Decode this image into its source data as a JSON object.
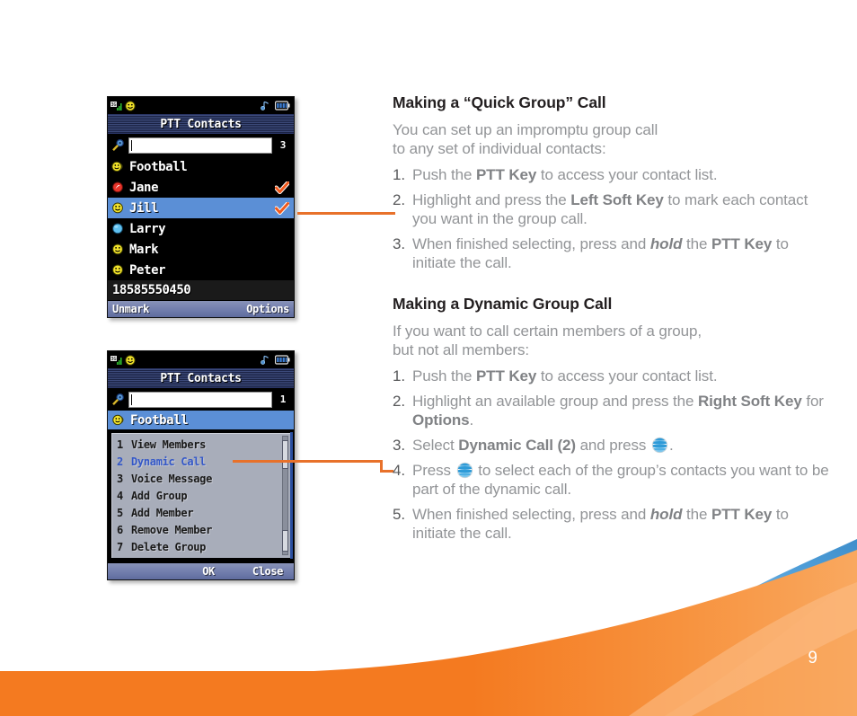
{
  "page": {
    "number": "9",
    "accent_orange": "#f47920",
    "accent_blue": "#5b9bd5",
    "callout_color": "#e8712a",
    "body_text_color": "#929497",
    "heading_color": "#231f20"
  },
  "phone1": {
    "statusbar": {
      "signal_icon": "3g-signal-icon",
      "presence_icon": "smiley-icon",
      "music_icon": "music-note-icon",
      "battery_icon": "battery-icon"
    },
    "title": "PTT Contacts",
    "search": {
      "value": "",
      "placeholder": "",
      "count": "3",
      "icon": "search-magnifier-icon"
    },
    "contacts": [
      {
        "name": "Football",
        "presence": "group-smiley",
        "checked": false,
        "selected": false
      },
      {
        "name": "Jane",
        "presence": "red-busy",
        "checked": true,
        "selected": false
      },
      {
        "name": "Jill",
        "presence": "yellow-smiley",
        "checked": true,
        "selected": true
      },
      {
        "name": "Larry",
        "presence": "blue-offline",
        "checked": false,
        "selected": false
      },
      {
        "name": "Mark",
        "presence": "yellow-smiley",
        "checked": false,
        "selected": false
      },
      {
        "name": "Peter",
        "presence": "yellow-smiley",
        "checked": false,
        "selected": false
      }
    ],
    "number": "18585550450",
    "softkeys": {
      "left": "Unmark",
      "right": "Options"
    }
  },
  "phone2": {
    "statusbar": {
      "signal_icon": "3g-signal-icon",
      "presence_icon": "smiley-icon",
      "music_icon": "music-note-icon",
      "battery_icon": "battery-icon"
    },
    "title": "PTT Contacts",
    "search": {
      "value": "",
      "placeholder": "",
      "count": "1",
      "icon": "search-magnifier-icon"
    },
    "group": {
      "name": "Football",
      "presence": "group-smiley"
    },
    "menu": [
      {
        "num": "1",
        "label": "View Members",
        "highlighted": false
      },
      {
        "num": "2",
        "label": "Dynamic Call",
        "highlighted": true
      },
      {
        "num": "3",
        "label": "Voice Message",
        "highlighted": false
      },
      {
        "num": "4",
        "label": "Add Group",
        "highlighted": false
      },
      {
        "num": "5",
        "label": "Add Member",
        "highlighted": false
      },
      {
        "num": "6",
        "label": "Remove Member",
        "highlighted": false
      },
      {
        "num": "7",
        "label": "Delete Group",
        "highlighted": false
      }
    ],
    "softkeys": {
      "left": "OK",
      "right": "Close"
    }
  },
  "section1": {
    "heading": "Making a “Quick Group” Call",
    "lead_line1": "You can set up an impromptu group call",
    "lead_line2": "to any set of individual contacts:",
    "steps": [
      {
        "num": "1.",
        "parts": [
          {
            "t": "Push the ",
            "b": false
          },
          {
            "t": "PTT Key",
            "b": true
          },
          {
            "t": " to access your contact list.",
            "b": false
          }
        ]
      },
      {
        "num": "2.",
        "parts": [
          {
            "t": "Highlight and press the ",
            "b": false
          },
          {
            "t": "Left Soft Key",
            "b": true
          },
          {
            "t": " to mark each contact you want in the group call.",
            "b": false
          }
        ]
      },
      {
        "num": "3.",
        "parts": [
          {
            "t": "When finished selecting, press and ",
            "b": false
          },
          {
            "t": "hold",
            "i": true
          },
          {
            "t": " the ",
            "b": false
          },
          {
            "t": "PTT Key",
            "b": true
          },
          {
            "t": " to initiate the call.",
            "b": false
          }
        ]
      }
    ]
  },
  "section2": {
    "heading": "Making a Dynamic Group Call",
    "lead_line1": "If you want to call certain members of a group,",
    "lead_line2": "but not all members:",
    "steps": [
      {
        "num": "1.",
        "parts": [
          {
            "t": "Push the ",
            "b": false
          },
          {
            "t": "PTT Key",
            "b": true
          },
          {
            "t": " to access your contact list.",
            "b": false
          }
        ]
      },
      {
        "num": "2.",
        "parts": [
          {
            "t": "Highlight an available group and press the ",
            "b": false
          },
          {
            "t": "Right Soft Key",
            "b": true
          },
          {
            "t": " for ",
            "b": false
          },
          {
            "t": "Options",
            "b": true
          },
          {
            "t": ".",
            "b": false
          }
        ]
      },
      {
        "num": "3.",
        "parts": [
          {
            "t": "Select ",
            "b": false
          },
          {
            "t": "Dynamic Call (2)",
            "b": true
          },
          {
            "t": " and press ",
            "b": false
          },
          {
            "icon": "att-globe-icon"
          },
          {
            "t": ".",
            "b": false
          }
        ]
      },
      {
        "num": "4.",
        "parts": [
          {
            "t": "Press ",
            "b": false
          },
          {
            "icon": "att-globe-icon"
          },
          {
            "t": " to select each of the group’s contacts you want to be part of the dynamic call.",
            "b": false
          }
        ]
      },
      {
        "num": "5.",
        "parts": [
          {
            "t": "When finished selecting, press and ",
            "b": false
          },
          {
            "t": "hold",
            "i": true
          },
          {
            "t": " the ",
            "b": false
          },
          {
            "t": "PTT Key",
            "b": true
          },
          {
            "t": " to initiate the call.",
            "b": false
          }
        ]
      }
    ]
  }
}
